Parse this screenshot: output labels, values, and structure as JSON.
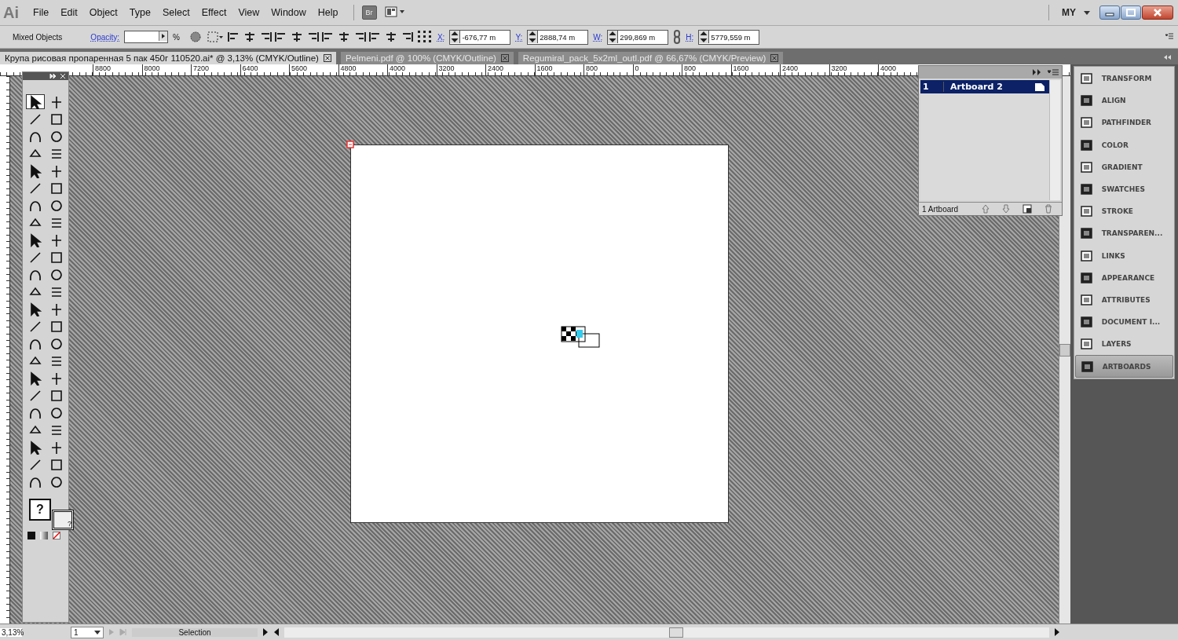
{
  "app_logo": "Ai",
  "menu": [
    "File",
    "Edit",
    "Object",
    "Type",
    "Select",
    "Effect",
    "View",
    "Window",
    "Help"
  ],
  "bridge_button": "Br",
  "workspace": "MY",
  "control_bar": {
    "selection": "Mixed Objects",
    "opacity_label": "Opacity:",
    "opacity_unit": "%",
    "fields": [
      {
        "label": "X:",
        "value": "-676,77 m"
      },
      {
        "label": "Y:",
        "value": "2888,74 m"
      },
      {
        "label": "W:",
        "value": "299,869 m"
      },
      {
        "label": "H:",
        "value": "5779,559 m"
      }
    ]
  },
  "document_tabs": [
    {
      "title": "Крупа рисовая пропаренная 5 пак 450г  110520.ai* @ 3,13% (CMYK/Outline)",
      "selected": true
    },
    {
      "title": "Pelmeni.pdf @ 100% (CMYK/Outline)",
      "selected": false
    },
    {
      "title": "Regumiral_pack_5x2ml_outl.pdf @ 66,67% (CMYK/Preview)",
      "selected": false
    }
  ],
  "ruler_labels": [
    "8800",
    "8000",
    "7200",
    "6400",
    "5600",
    "4800",
    "4000",
    "3200",
    "2400",
    "1600",
    "800",
    "0",
    "800",
    "1600",
    "2400",
    "3200",
    "4000"
  ],
  "toolbox": {
    "tools": [
      {
        "selected": true
      },
      {
        "selected": false
      },
      {
        "selected": false
      },
      {
        "selected": false
      },
      {
        "selected": false
      },
      {
        "selected": false
      },
      {
        "selected": false
      },
      {
        "selected": false
      },
      {
        "selected": false
      },
      {
        "selected": false
      },
      {
        "selected": false
      },
      {
        "selected": false
      },
      {
        "selected": false
      },
      {
        "selected": false
      },
      {
        "selected": false
      },
      {
        "selected": false
      },
      {
        "selected": false
      },
      {
        "selected": false
      },
      {
        "selected": false
      },
      {
        "selected": false
      },
      {
        "selected": false
      },
      {
        "selected": false
      },
      {
        "selected": false
      },
      {
        "selected": false
      },
      {
        "selected": false
      },
      {
        "selected": false
      },
      {
        "selected": false
      },
      {
        "selected": false
      },
      {
        "selected": false
      },
      {
        "selected": false
      },
      {
        "selected": false
      },
      {
        "selected": false
      },
      {
        "selected": false
      },
      {
        "selected": false
      },
      {
        "selected": false
      },
      {
        "selected": false
      },
      {
        "selected": false
      },
      {
        "selected": false
      },
      {
        "selected": false
      },
      {
        "selected": false
      },
      {
        "selected": false
      },
      {
        "selected": false
      },
      {
        "selected": false
      },
      {
        "selected": false
      },
      {
        "selected": false
      },
      {
        "selected": false
      }
    ],
    "fill": "?",
    "stroke": "?"
  },
  "artboards_panel": {
    "rows": [
      {
        "number": "1",
        "name": "Artboard 2",
        "selected": true
      }
    ],
    "footer": "1 Artboard"
  },
  "panel_dock": [
    {
      "label": "TRANSFORM",
      "selected": false
    },
    {
      "label": "ALIGN",
      "selected": false
    },
    {
      "label": "PATHFINDER",
      "selected": false
    },
    {
      "label": "COLOR",
      "selected": false
    },
    {
      "label": "GRADIENT",
      "selected": false
    },
    {
      "label": "SWATCHES",
      "selected": false
    },
    {
      "label": "STROKE",
      "selected": false
    },
    {
      "label": "TRANSPAREN...",
      "selected": false
    },
    {
      "label": "LINKS",
      "selected": false
    },
    {
      "label": "APPEARANCE",
      "selected": false
    },
    {
      "label": "ATTRIBUTES",
      "selected": false
    },
    {
      "label": "DOCUMENT I...",
      "selected": false
    },
    {
      "label": "LAYERS",
      "selected": false
    },
    {
      "label": "ARTBOARDS",
      "selected": true
    }
  ],
  "status_bar": {
    "zoom": "3,13%",
    "artboard": "1",
    "tool": "Selection"
  }
}
